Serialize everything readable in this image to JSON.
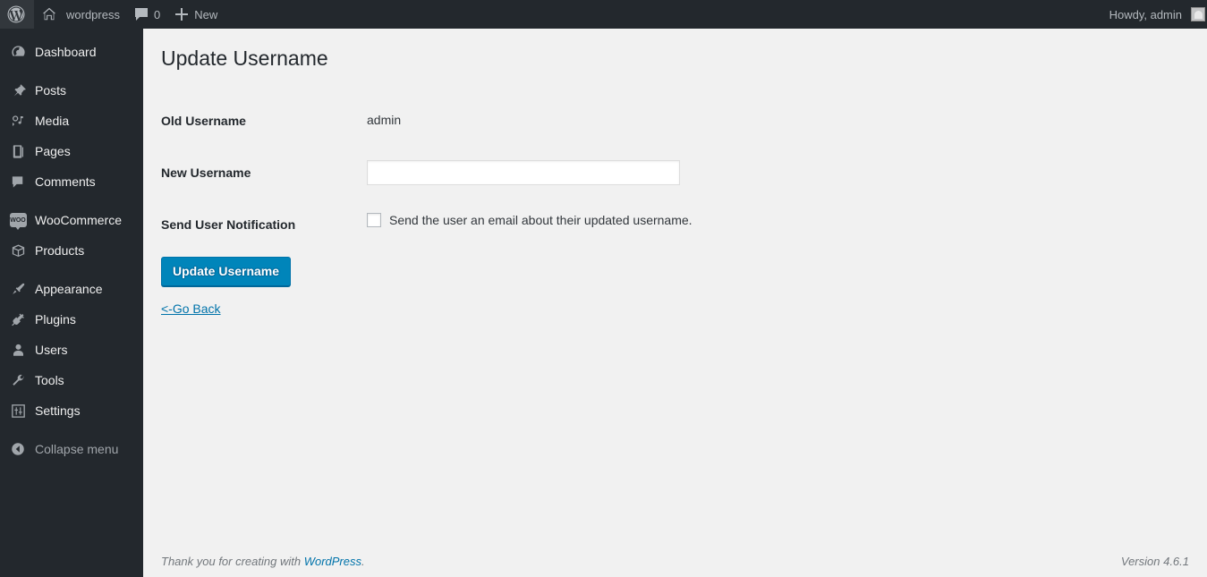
{
  "adminbar": {
    "wp_logo_icon": "wordpress-logo-icon",
    "site_home_icon": "home-icon",
    "site_name": "wordpress",
    "comments_icon": "comment-bubble-icon",
    "comments_count": "0",
    "new_icon": "plus-icon",
    "new_label": "New",
    "howdy": "Howdy, admin",
    "avatar_icon": "avatar-image"
  },
  "sidebar": {
    "items": [
      {
        "label": "Dashboard",
        "icon": "dashboard-icon"
      },
      {
        "label": "Posts",
        "icon": "pin-icon"
      },
      {
        "label": "Media",
        "icon": "media-icon"
      },
      {
        "label": "Pages",
        "icon": "page-icon"
      },
      {
        "label": "Comments",
        "icon": "comment-bubble-icon"
      },
      {
        "label": "WooCommerce",
        "icon": "woocommerce-icon"
      },
      {
        "label": "Products",
        "icon": "products-box-icon"
      },
      {
        "label": "Appearance",
        "icon": "paintbrush-icon"
      },
      {
        "label": "Plugins",
        "icon": "plugin-icon"
      },
      {
        "label": "Users",
        "icon": "user-icon"
      },
      {
        "label": "Tools",
        "icon": "wrench-icon"
      },
      {
        "label": "Settings",
        "icon": "sliders-icon"
      }
    ],
    "collapse": {
      "label": "Collapse menu",
      "icon": "collapse-arrow-icon"
    }
  },
  "main": {
    "page_title": "Update Username",
    "fields": {
      "old_username_label": "Old Username",
      "old_username_value": "admin",
      "new_username_label": "New Username",
      "new_username_value": "",
      "new_username_placeholder": "",
      "notification_label": "Send User Notification",
      "notification_checkbox_label": "Send the user an email about their updated username.",
      "notification_checked": false
    },
    "submit_label": "Update Username",
    "go_back_label": "<-Go Back"
  },
  "footer": {
    "thanks_prefix": "Thank you for creating with ",
    "wordpress_link": "WordPress",
    "thanks_suffix": ".",
    "version": "Version 4.6.1"
  },
  "colors": {
    "sidebar_bg": "#23282d",
    "content_bg": "#f1f1f1",
    "primary_button": "#0085ba",
    "link": "#0073aa",
    "text": "#23282d"
  }
}
